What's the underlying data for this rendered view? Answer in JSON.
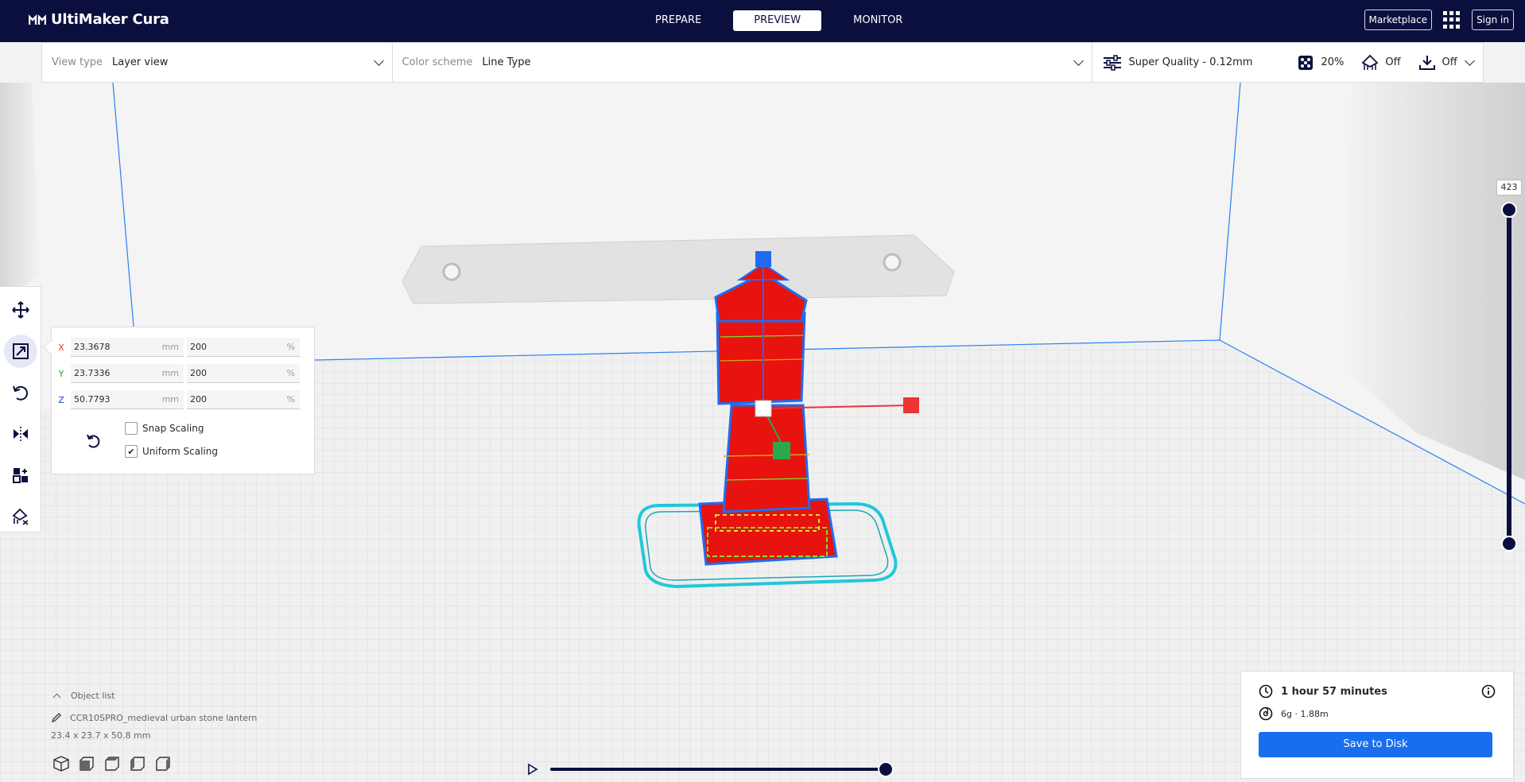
{
  "app": {
    "title": "UltiMaker Cura"
  },
  "stages": [
    {
      "label": "PREPARE",
      "active": false
    },
    {
      "label": "PREVIEW",
      "active": true
    },
    {
      "label": "MONITOR",
      "active": false
    }
  ],
  "top_right": {
    "marketplace": "Marketplace",
    "sign_in": "Sign in"
  },
  "toolbar": {
    "view_type_label": "View type",
    "view_type_value": "Layer view",
    "color_scheme_label": "Color scheme",
    "color_scheme_value": "Line Type",
    "quality": "Super Quality - 0.12mm",
    "infill": "20%",
    "support": "Off",
    "adhesion": "Off"
  },
  "scale_panel": {
    "x_mm": "23.3678",
    "x_pct": "200",
    "y_mm": "23.7336",
    "y_pct": "200",
    "z_mm": "50.7793",
    "z_pct": "200",
    "x_axis": "X",
    "y_axis": "Y",
    "z_axis": "Z",
    "unit_mm": "mm",
    "unit_pct": "%",
    "snap_label": "Snap Scaling",
    "snap_checked": false,
    "uniform_label": "Uniform Scaling",
    "uniform_checked": true
  },
  "layer_slider": {
    "value": "423"
  },
  "object_list": {
    "header": "Object list",
    "item": "CCR10SPRO_medieval urban stone lantern",
    "dimensions": "23.4 x 23.7 x 50.8 mm"
  },
  "output": {
    "time": "1 hour 57 minutes",
    "material": "6g · 1.88m",
    "save_label": "Save to Disk"
  },
  "colors": {
    "topbar": "#0b0f3e",
    "accent": "#196ef0",
    "model": "#e8120f",
    "skirt": "#20c8d8"
  },
  "simulation_progress": 1.0
}
